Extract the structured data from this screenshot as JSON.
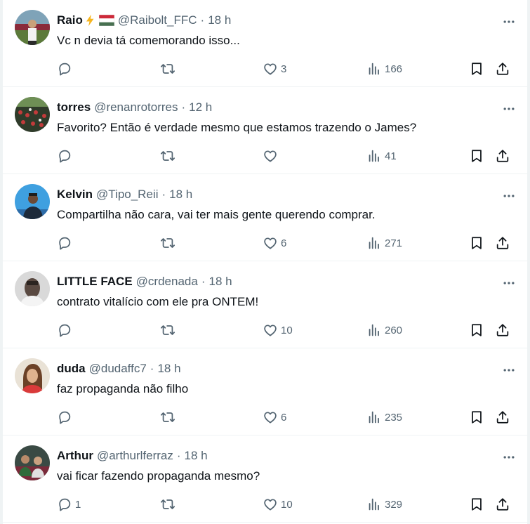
{
  "replies": [
    {
      "name": "Raio",
      "name_emoji": [
        "lightning-emoji",
        "hungary-flag-emoji"
      ],
      "handle": "@Raibolt_FFC",
      "time": "18 h",
      "text": "Vc n devia tá comemorando isso...",
      "reply_count": "",
      "retweet_count": "",
      "like_count": "3",
      "view_count": "166"
    },
    {
      "name": "torres",
      "handle": "@renanrotorres",
      "time": "12 h",
      "text": "Favorito? Então é verdade mesmo que estamos trazendo o James?",
      "reply_count": "",
      "retweet_count": "",
      "like_count": "",
      "view_count": "41"
    },
    {
      "name": "Kelvin",
      "handle": "@Tipo_Reii",
      "time": "18 h",
      "text": "Compartilha não cara, vai ter mais gente querendo comprar.",
      "reply_count": "",
      "retweet_count": "",
      "like_count": "6",
      "view_count": "271"
    },
    {
      "name": "LITTLE FACE",
      "handle": "@crdenada",
      "time": "18 h",
      "text": "contrato vitalício com ele pra ONTEM!",
      "reply_count": "",
      "retweet_count": "",
      "like_count": "10",
      "view_count": "260"
    },
    {
      "name": "duda",
      "handle": "@dudaffc7",
      "time": "18 h",
      "text": "faz propaganda não filho",
      "reply_count": "",
      "retweet_count": "",
      "like_count": "6",
      "view_count": "235"
    },
    {
      "name": "Arthur",
      "handle": "@arthurlferraz",
      "time": "18 h",
      "text": "vai ficar fazendo propaganda mesmo?",
      "reply_count": "1",
      "retweet_count": "",
      "like_count": "10",
      "view_count": "329"
    }
  ],
  "separator": "·",
  "colors": {
    "text_primary": "#0f1419",
    "text_secondary": "#536471",
    "divider": "#eff3f4"
  }
}
